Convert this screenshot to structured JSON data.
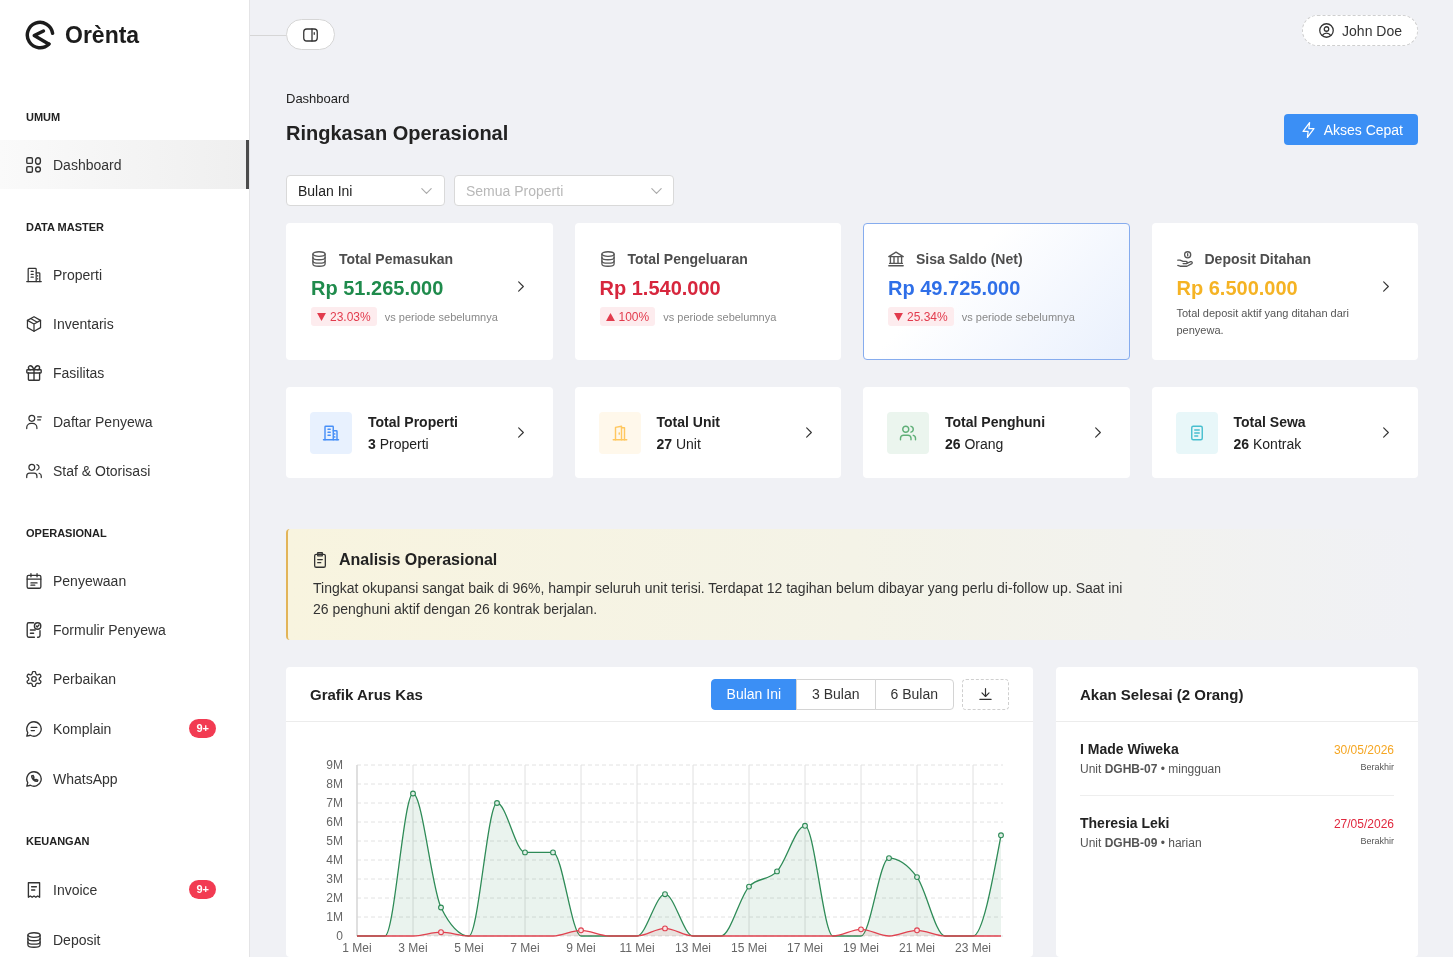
{
  "sidebar": {
    "brand": "Orènta",
    "sections": [
      {
        "title": "UMUM",
        "items": [
          {
            "label": "Dashboard",
            "selected": true
          }
        ]
      },
      {
        "title": "DATA MASTER",
        "items": [
          {
            "label": "Properti",
            "selected": false
          },
          {
            "label": "Inventaris",
            "selected": false
          },
          {
            "label": "Fasilitas",
            "selected": false
          },
          {
            "label": "Daftar Penyewa",
            "selected": false
          },
          {
            "label": "Staf & Otorisasi",
            "selected": false
          }
        ]
      },
      {
        "title": "OPERASIONAL",
        "items": [
          {
            "label": "Penyewaan",
            "selected": false
          },
          {
            "label": "Formulir Penyewa",
            "selected": false
          },
          {
            "label": "Perbaikan",
            "selected": false
          },
          {
            "label": "Komplain",
            "selected": false,
            "badge": "9+"
          },
          {
            "label": "WhatsApp",
            "selected": false
          }
        ]
      },
      {
        "title": "KEUANGAN",
        "items": [
          {
            "label": "Invoice",
            "selected": false,
            "badge": "9+"
          },
          {
            "label": "Deposit",
            "selected": false
          }
        ]
      }
    ]
  },
  "topbar": {
    "user": "John Doe"
  },
  "header": {
    "breadcrumb": "Dashboard",
    "title": "Ringkasan Operasional",
    "action": "Akses Cepat"
  },
  "filters": [
    {
      "value": "Bulan Ini"
    },
    {
      "placeholder": "Semua Properti"
    }
  ],
  "stat_cards": [
    {
      "kind": "trend",
      "label": "Total Pemasukan",
      "value": "Rp 51.265.000",
      "color": "#1f8b4c",
      "trend": {
        "up": false,
        "text": "23.03%"
      },
      "note": "vs periode sebelumnya",
      "chevron": true,
      "selected": false
    },
    {
      "kind": "trend",
      "label": "Total Pengeluaran",
      "value": "Rp 1.540.000",
      "color": "#d7263d",
      "trend": {
        "up": true,
        "text": "100%"
      },
      "note": "vs periode sebelumnya",
      "chevron": false,
      "selected": false
    },
    {
      "kind": "trend",
      "label": "Sisa Saldo (Net)",
      "value": "Rp 49.725.000",
      "color": "#2f6fe8",
      "trend": {
        "up": false,
        "text": "25.34%"
      },
      "note": "vs periode sebelumnya",
      "chevron": false,
      "selected": true
    },
    {
      "kind": "description",
      "label": "Deposit Ditahan",
      "value": "Rp 6.500.000",
      "color": "#f5b324",
      "description": "Total deposit aktif yang ditahan dari penyewa.",
      "chevron": true,
      "selected": false
    }
  ],
  "count_cards": [
    {
      "title": "Total Properti",
      "value": "**3** Properti",
      "color": "#e8f1fe"
    },
    {
      "title": "Total Unit",
      "value": "**27** Unit",
      "color": "#fff8eb"
    },
    {
      "title": "Total Penghuni",
      "value": "**26** Orang",
      "color": "#ebf5ee"
    },
    {
      "title": "Total Sewa",
      "value": "**26** Kontrak",
      "color": "#e8f7f9"
    }
  ],
  "analysis": {
    "title": "Analisis Operasional",
    "text": "Tingkat okupansi sangat baik di 96%, hampir seluruh unit terisi. Terdapat 12 tagihan belum dibayar yang perlu di-follow up. Saat ini 26 penghuni aktif dengan 26 kontrak berjalan."
  },
  "cash_flow": {
    "ranges": [
      {
        "label": "Bulan Ini",
        "selected": true
      },
      {
        "label": "3 Bulan",
        "selected": false
      },
      {
        "label": "6 Bulan",
        "selected": false
      }
    ],
    "chart_data": {
      "type": "area",
      "title": "Grafik Arus Kas",
      "grid": true,
      "x": [
        1,
        2,
        3,
        4,
        5,
        6,
        7,
        8,
        9,
        10,
        11,
        12,
        13,
        14,
        15,
        16,
        17,
        18,
        19,
        20,
        21,
        22,
        23,
        24
      ],
      "xlim": [
        1,
        24
      ],
      "ylim": [
        0,
        9000000
      ],
      "xticks": [
        {
          "value": 1,
          "label": "1 Mei"
        },
        {
          "value": 3,
          "label": "3 Mei"
        },
        {
          "value": 5,
          "label": "5 Mei"
        },
        {
          "value": 7,
          "label": "7 Mei"
        },
        {
          "value": 9,
          "label": "9 Mei"
        },
        {
          "value": 11,
          "label": "11 Mei"
        },
        {
          "value": 13,
          "label": "13 Mei"
        },
        {
          "value": 15,
          "label": "15 Mei"
        },
        {
          "value": 17,
          "label": "17 Mei"
        },
        {
          "value": 19,
          "label": "19 Mei"
        },
        {
          "value": 21,
          "label": "21 Mei"
        },
        {
          "value": 23,
          "label": "23 Mei"
        }
      ],
      "yticks": [
        {
          "value": 0,
          "label": "0"
        },
        {
          "value": 1000000,
          "label": "1M"
        },
        {
          "value": 2000000,
          "label": "2M"
        },
        {
          "value": 3000000,
          "label": "3M"
        },
        {
          "value": 4000000,
          "label": "4M"
        },
        {
          "value": 5000000,
          "label": "5M"
        },
        {
          "value": 6000000,
          "label": "6M"
        },
        {
          "value": 7000000,
          "label": "7M"
        },
        {
          "value": 8000000,
          "label": "8M"
        },
        {
          "value": 9000000,
          "label": "9M"
        }
      ],
      "series": [
        {
          "color": "#2e8b57",
          "values": [
            0,
            0,
            7500000,
            1500000,
            0,
            7000000,
            4400000,
            4400000,
            0,
            0,
            0,
            2200000,
            0,
            0,
            2600000,
            3400000,
            5800000,
            0,
            0,
            4100000,
            3100000,
            0,
            0,
            5300000
          ]
        },
        {
          "color": "#e0414f",
          "values": [
            0,
            0,
            0,
            200000,
            0,
            0,
            0,
            0,
            300000,
            0,
            0,
            400000,
            0,
            0,
            0,
            0,
            0,
            0,
            350000,
            0,
            300000,
            0,
            0,
            0
          ]
        }
      ]
    }
  },
  "ending_soon": {
    "title": "Akan Selesai (2 Orang)",
    "items": [
      {
        "name": "I Made Wiweka",
        "detail": "Unit **DGHB-07** • mingguan",
        "date": "30/05/2026",
        "color": "#f5a623",
        "status": "Berakhir"
      },
      {
        "name": "Theresia Leki",
        "detail": "Unit **DGHB-09** • harian",
        "date": "27/05/2026",
        "color": "#e0283e",
        "status": "Berakhir"
      }
    ]
  }
}
